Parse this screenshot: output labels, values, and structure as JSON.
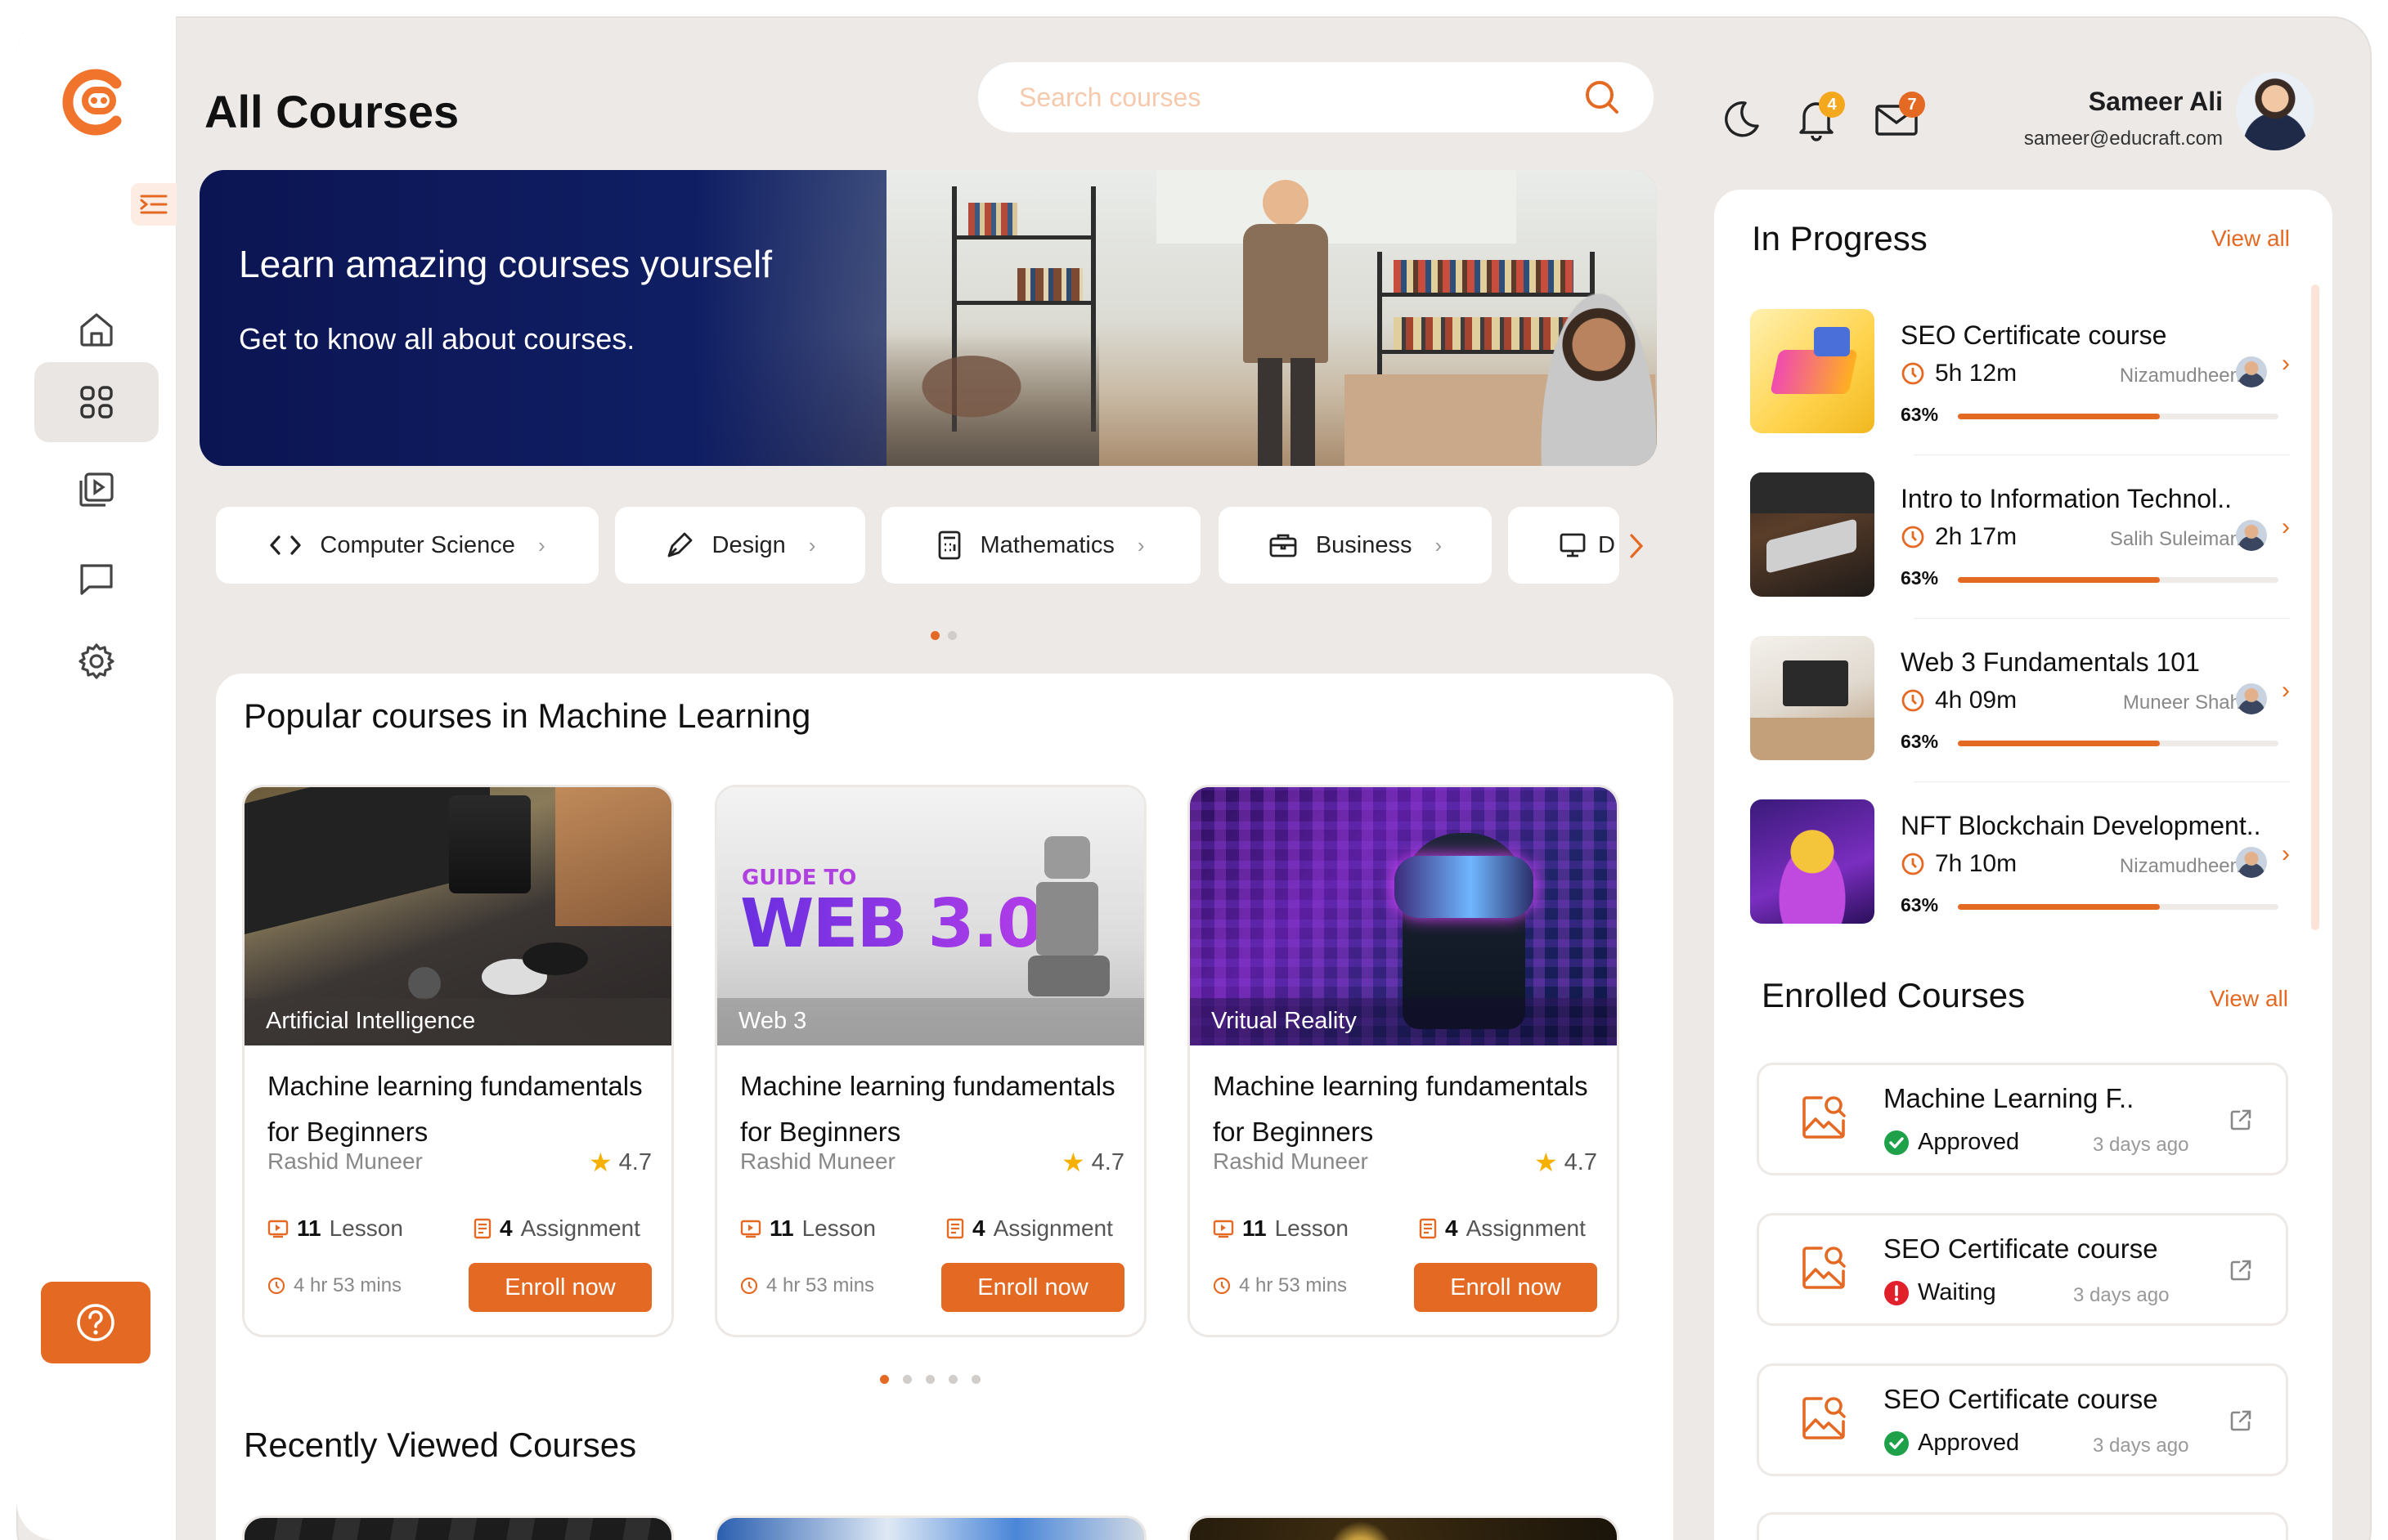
{
  "header": {
    "page_title": "All Courses",
    "search_placeholder": "Search courses",
    "notifications_count": "4",
    "messages_count": "7",
    "user_name": "Sameer Ali",
    "user_email": "sameer@educraft.com"
  },
  "banner": {
    "title": "Learn amazing courses yourself",
    "subtitle": "Get to know all about courses."
  },
  "categories": [
    {
      "label": "Computer Science",
      "icon": "code-icon"
    },
    {
      "label": "Design",
      "icon": "pen-icon"
    },
    {
      "label": "Mathematics",
      "icon": "calculator-icon"
    },
    {
      "label": "Business",
      "icon": "briefcase-icon"
    },
    {
      "label": "D",
      "icon": "monitor-icon"
    }
  ],
  "popular": {
    "title": "Popular courses in Machine Learning",
    "courses": [
      {
        "tag": "Artificial Intelligence",
        "title": "Machine learning fundamentals for Beginners",
        "author": "Rashid Muneer",
        "rating": "4.7",
        "lessons_count": "11",
        "lessons_label": "Lesson",
        "assign_count": "4",
        "assign_label": "Assignment",
        "duration": "4 hr 53 mins",
        "cta": "Enroll now"
      },
      {
        "tag": "Web 3",
        "title": "Machine learning fundamentals for Beginners",
        "author": "Rashid Muneer",
        "rating": "4.7",
        "lessons_count": "11",
        "lessons_label": "Lesson",
        "assign_count": "4",
        "assign_label": "Assignment",
        "duration": "4 hr 53 mins",
        "cta": "Enroll now",
        "thumb_text_1": "GUIDE TO",
        "thumb_text_2": "WEB 3.0"
      },
      {
        "tag": "Vritual Reality",
        "title": "Machine learning fundamentals for Beginners",
        "author": "Rashid Muneer",
        "rating": "4.7",
        "lessons_count": "11",
        "lessons_label": "Lesson",
        "assign_count": "4",
        "assign_label": "Assignment",
        "duration": "4 hr 53 mins",
        "cta": "Enroll now"
      }
    ]
  },
  "recent": {
    "title": "Recently Viewed Courses"
  },
  "in_progress": {
    "title": "In Progress",
    "view_all": "View all",
    "items": [
      {
        "title": "SEO Certificate course",
        "duration": "5h 12m",
        "instructor": "Nizamudheen",
        "percent": "63%",
        "progress": 0.63
      },
      {
        "title": "Intro to Information Technol..",
        "duration": "2h 17m",
        "instructor": "Salih Suleiman",
        "percent": "63%",
        "progress": 0.63
      },
      {
        "title": "Web 3 Fundamentals 101",
        "duration": "4h 09m",
        "instructor": "Muneer Shah",
        "percent": "63%",
        "progress": 0.63
      },
      {
        "title": "NFT Blockchain Development..",
        "duration": "7h 10m",
        "instructor": "Nizamudheen",
        "percent": "63%",
        "progress": 0.63
      }
    ]
  },
  "enrolled": {
    "title": "Enrolled Courses",
    "view_all": "View all",
    "items": [
      {
        "title": "Machine Learning F..",
        "status": "Approved",
        "time": "3 days ago",
        "status_color": "#1fa14a"
      },
      {
        "title": "SEO Certificate course",
        "status": "Waiting",
        "time": "3 days ago",
        "status_color": "#e0202a"
      },
      {
        "title": "SEO Certificate course",
        "status": "Approved",
        "time": "3 days ago",
        "status_color": "#1fa14a"
      }
    ]
  },
  "colors": {
    "accent": "#e46a24",
    "navy": "#0c1553"
  }
}
